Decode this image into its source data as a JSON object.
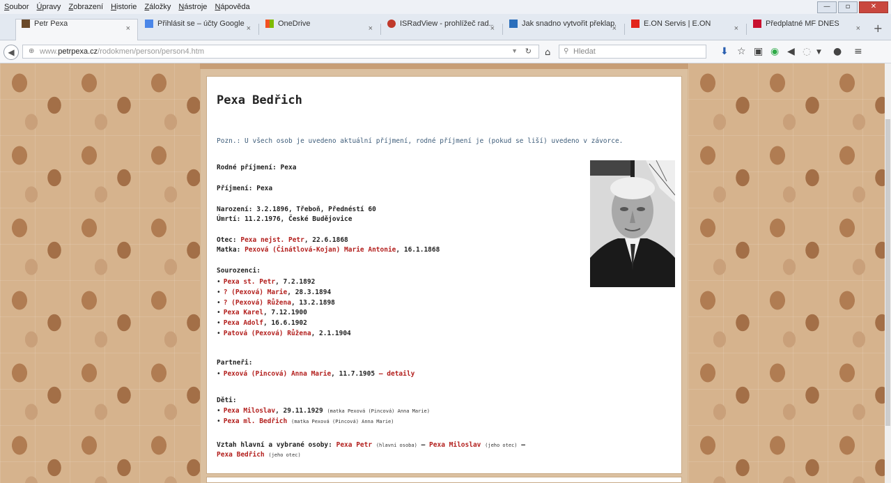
{
  "menubar": {
    "items": [
      "Soubor",
      "Úpravy",
      "Zobrazení",
      "Historie",
      "Záložky",
      "Nástroje",
      "Nápověda"
    ]
  },
  "window_controls": {
    "minimize": "—",
    "maximize": "▫",
    "close": "✕"
  },
  "tabs": [
    {
      "label": "Petr Pexa",
      "active": true
    },
    {
      "label": "Přihlásit se – účty Google",
      "active": false
    },
    {
      "label": "OneDrive",
      "active": false
    },
    {
      "label": "ISRadView - prohlížeč rad...",
      "active": false
    },
    {
      "label": "Jak snadno vytvořit překlap...",
      "active": false
    },
    {
      "label": "E.ON Servis | E.ON",
      "active": false
    },
    {
      "label": "Předplatné MF DNES",
      "active": false
    }
  ],
  "tab_close_glyph": "×",
  "new_tab_glyph": "+",
  "nav": {
    "url_prefix": "www.",
    "url_host": "petrpexa.cz",
    "url_path": "/rodokmen/person/person4.htm",
    "search_placeholder": "Hledat"
  },
  "person": {
    "name": "Pexa Bedřich",
    "note": "Pozn.: U všech osob je uvedeno aktuální příjmení, rodné příjmení je (pokud se liší) uvedeno v závorce.",
    "birth_surname_label": "Rodné příjmení:",
    "birth_surname": "Pexa",
    "surname_label": "Příjmení:",
    "surname": "Pexa",
    "birth_label": "Narození:",
    "birth": "3.2.1896, Třeboň, Přednéstí 60",
    "death_label": "Úmrtí:",
    "death": "11.2.1976, České Budějovice",
    "father_label": "Otec:",
    "father_name": "Pexa nejst. Petr",
    "father_date": ", 22.6.1868",
    "mother_label": "Matka:",
    "mother_name": "Pexová (Činátlová-Kojan) Marie Antonie",
    "mother_date": ", 16.1.1868",
    "siblings_label": "Sourozenci:",
    "siblings": [
      {
        "name": "Pexa st. Petr",
        "date": ", 7.2.1892"
      },
      {
        "name": "? (Pexová) Marie",
        "date": ", 28.3.1894"
      },
      {
        "name": "? (Pexová) Růžena",
        "date": ", 13.2.1898"
      },
      {
        "name": "Pexa Karel",
        "date": ", 7.12.1900"
      },
      {
        "name": "Pexa Adolf",
        "date": ", 16.6.1902"
      },
      {
        "name": "Patová (Pexová) Růžena",
        "date": ", 2.1.1904"
      }
    ],
    "partners_label": "Partneři:",
    "partner_name": "Pexová (Pincová) Anna Marie",
    "partner_date": ", 11.7.1905",
    "partner_detail": " – detaily",
    "children_label": "Děti:",
    "children": [
      {
        "name": "Pexa Miloslav",
        "date": ", 29.11.1929",
        "note": "(matka Pexová (Pincová) Anna Marie)"
      },
      {
        "name": "Pexa ml. Bedřich",
        "date": "",
        "note": "(matka Pexová (Pincová) Anna Marie)"
      }
    ],
    "relation_label": "Vztah hlavní a vybrané osoby:",
    "relation_main": "Pexa Petr",
    "relation_main_note": "(hlavní osoba)",
    "relation_mid": "Pexa Miloslav",
    "relation_mid_note": "(jeho otec)",
    "relation_target": "Pexa Bedřich",
    "relation_target_note": "(jeho otec)",
    "dash": "—"
  }
}
